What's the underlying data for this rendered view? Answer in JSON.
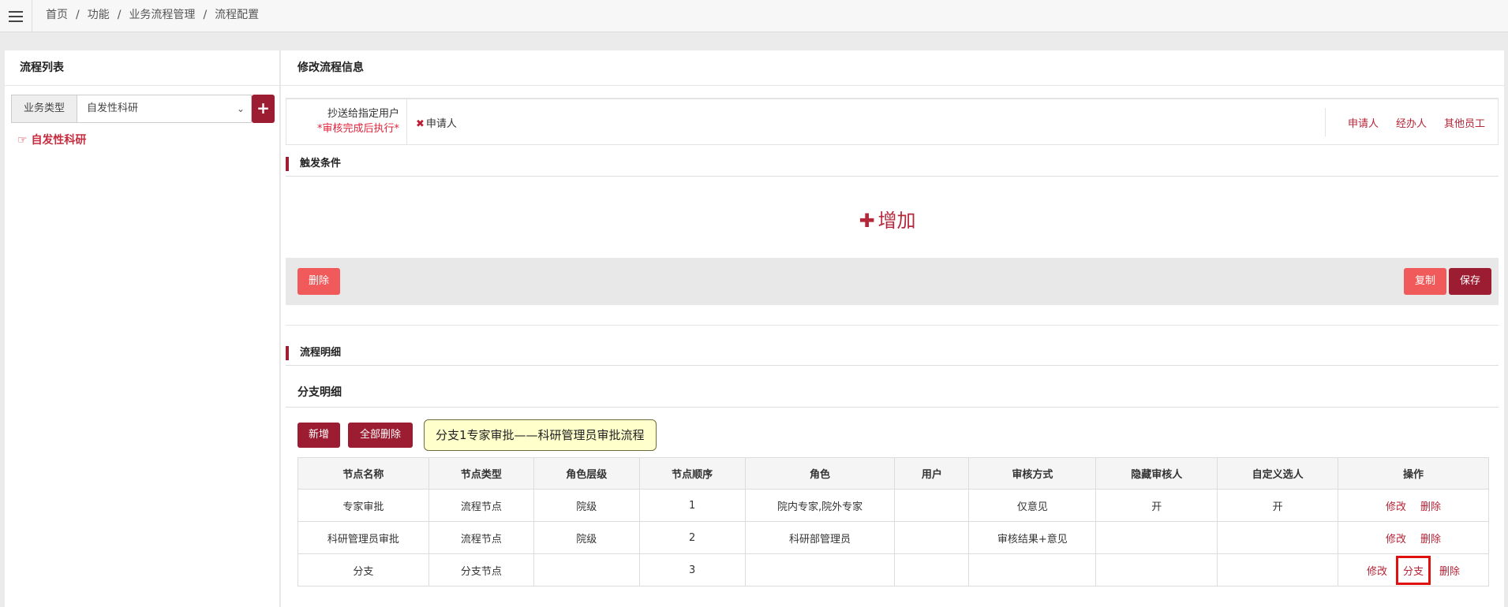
{
  "breadcrumb": [
    "首页",
    "功能",
    "业务流程管理",
    "流程配置"
  ],
  "left": {
    "title": "流程列表",
    "type_label": "业务类型",
    "type_selected": "自发性科研",
    "add_icon": "plus-icon",
    "tree_item": "自发性科研",
    "tree_icon": "hand-point-icon"
  },
  "right": {
    "title": "修改流程信息",
    "cc_label": "抄送给指定用户",
    "cc_note": "*审核完成后执行*",
    "cc_value": "申请人",
    "cc_remove_icon": "x-icon",
    "cc_links": [
      "申请人",
      "经办人",
      "其他员工"
    ],
    "trigger_title": "触发条件",
    "add_label": "增加",
    "delete_label": "删除",
    "copy_label": "复制",
    "save_label": "保存",
    "flow_detail_title": "流程明细",
    "branch_detail_title": "分支明细",
    "new_label": "新增",
    "delete_all_label": "全部删除",
    "tooltip": "分支1专家审批——科研管理员审批流程"
  },
  "table": {
    "headers": [
      "节点名称",
      "节点类型",
      "角色层级",
      "节点顺序",
      "角色",
      "用户",
      "审核方式",
      "隐藏审核人",
      "自定义选人",
      "操作"
    ],
    "rows": [
      {
        "name": "专家审批",
        "type": "流程节点",
        "level": "院级",
        "order": "1",
        "role": "院内专家,院外专家",
        "user": "",
        "method": "仅意见",
        "hidden": "开",
        "custom": "开",
        "ops": [
          "修改",
          "删除"
        ]
      },
      {
        "name": "科研管理员审批",
        "type": "流程节点",
        "level": "院级",
        "order": "2",
        "role": "科研部管理员",
        "user": "",
        "method": "审核结果+意见",
        "hidden": "",
        "custom": "",
        "ops": [
          "修改",
          "删除"
        ]
      },
      {
        "name": "分支",
        "type": "分支节点",
        "level": "",
        "order": "3",
        "role": "",
        "user": "",
        "method": "",
        "hidden": "",
        "custom": "",
        "ops": [
          "修改",
          "分支",
          "删除"
        ]
      }
    ]
  },
  "colors": {
    "brand": "#9c1c31",
    "light_red": "#f15a5a",
    "link": "#b52437",
    "highlight_border": "#e01010"
  }
}
